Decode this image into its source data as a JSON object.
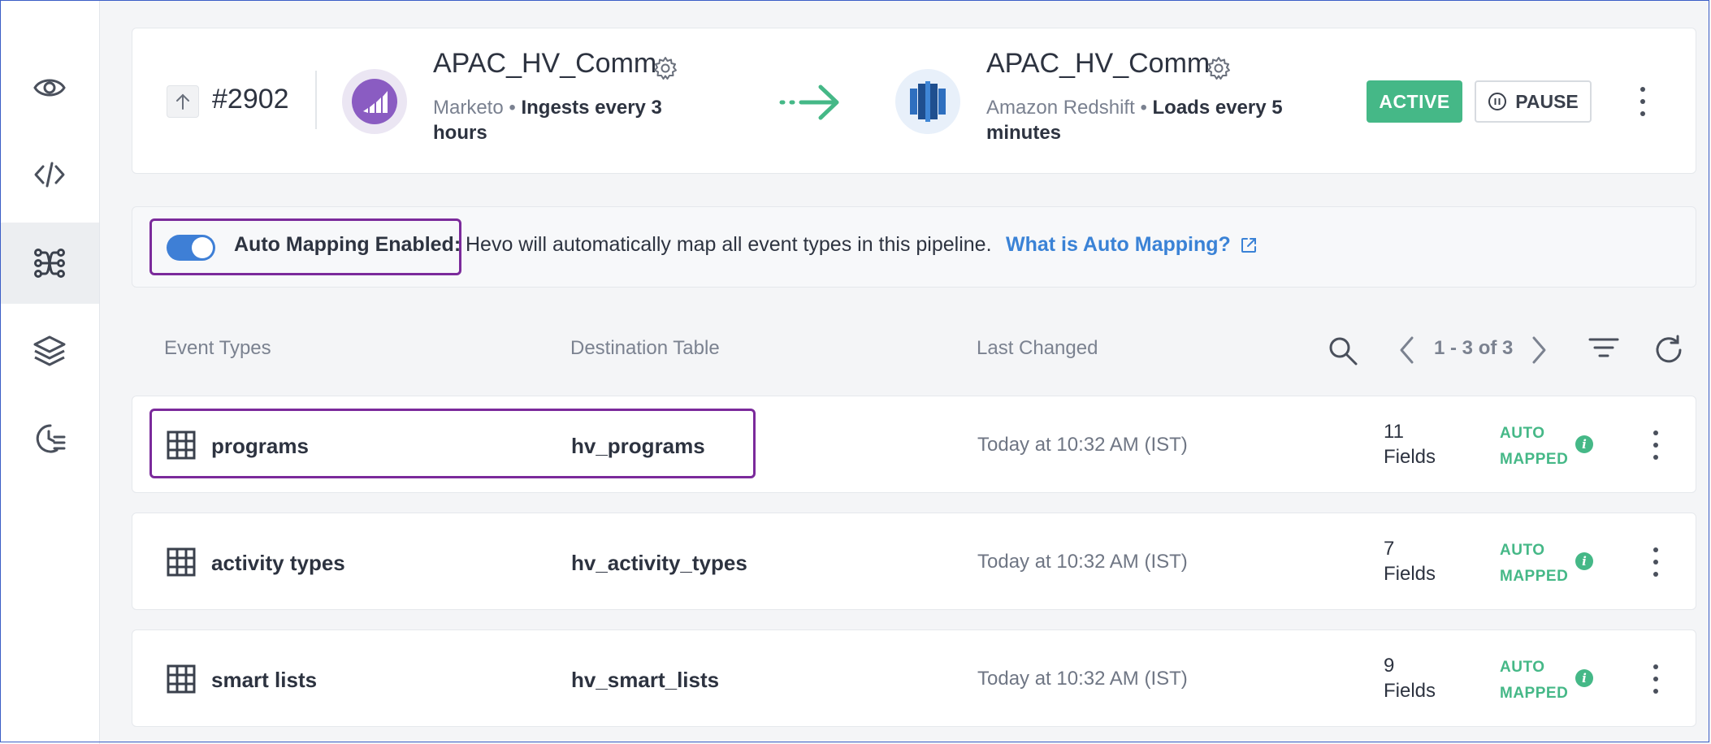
{
  "pipeline": {
    "id": "#2902",
    "status": "ACTIVE",
    "pause_label": "PAUSE",
    "status_color": "#45b887"
  },
  "source": {
    "name": "APAC_HV_Comm",
    "type": "Marketo",
    "bullet": "•",
    "schedule": "Ingests every 3",
    "schedule_cont": "hours"
  },
  "destination": {
    "name": "APAC_HV_Comm",
    "type": "Amazon Redshift",
    "bullet": "•",
    "schedule": "Loads every 5",
    "schedule_cont": "minutes"
  },
  "auto_mapping": {
    "label": "Auto Mapping Enabled:",
    "description": "Hevo will automatically map all event types in this pipeline.",
    "link": "What is Auto Mapping?",
    "enabled": true,
    "accent": "#3e7fd6"
  },
  "table": {
    "columns": {
      "event_types": "Event Types",
      "destination_table": "Destination Table",
      "last_changed": "Last Changed"
    },
    "pager": "1 - 3 of 3",
    "rows": [
      {
        "event_type": "programs",
        "destination_table": "hv_programs",
        "last_changed": "Today at 10:32 AM (IST)",
        "fields_count": "11",
        "fields_label": "Fields",
        "mapped_line1": "AUTO",
        "mapped_line2": "MAPPED"
      },
      {
        "event_type": "activity types",
        "destination_table": "hv_activity_types",
        "last_changed": "Today at 10:32 AM (IST)",
        "fields_count": "7",
        "fields_label": "Fields",
        "mapped_line1": "AUTO",
        "mapped_line2": "MAPPED"
      },
      {
        "event_type": "smart lists",
        "destination_table": "hv_smart_lists",
        "last_changed": "Today at 10:32 AM (IST)",
        "fields_count": "9",
        "fields_label": "Fields",
        "mapped_line1": "AUTO",
        "mapped_line2": "MAPPED"
      }
    ]
  },
  "icons": {
    "sidebar": [
      "eye-icon",
      "code-icon",
      "schema-mapper-icon",
      "layers-icon",
      "activity-log-icon"
    ],
    "info": "i"
  },
  "colors": {
    "highlight": "#7b2a9b",
    "link": "#3a82d6"
  }
}
